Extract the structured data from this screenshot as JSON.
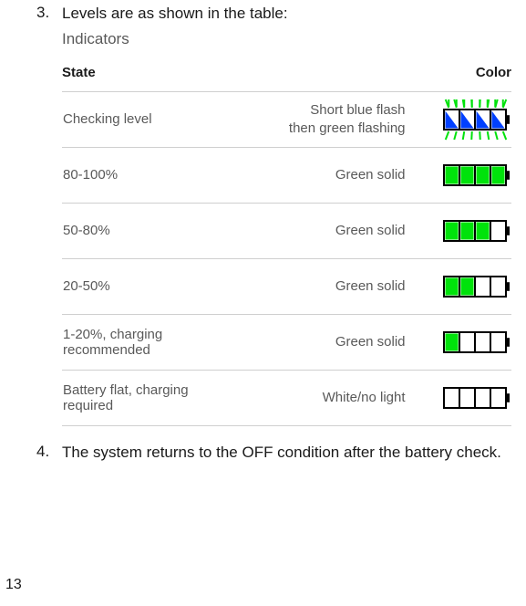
{
  "steps": {
    "item3": {
      "num": "3.",
      "text": "Levels are as shown in the table:"
    },
    "item4": {
      "num": "4.",
      "text": "The system returns to the OFF condition after the battery check."
    }
  },
  "indicators": {
    "title": "Indicators",
    "header_state": "State",
    "header_color": "Color",
    "colors": {
      "green": "#00e20b",
      "blue": "#0040ff",
      "outline": "#000000"
    },
    "rows": [
      {
        "state": "Checking level",
        "desc": "Short blue flash\nthen green flashing",
        "segments": 4,
        "fill": "blue_triangles_green_rays"
      },
      {
        "state": "80-100%",
        "desc": "Green solid",
        "segments": 4,
        "fill": 4
      },
      {
        "state": "50-80%",
        "desc": "Green solid",
        "segments": 4,
        "fill": 3
      },
      {
        "state": "20-50%",
        "desc": "Green solid",
        "segments": 4,
        "fill": 2
      },
      {
        "state": "1-20%, charging recommended",
        "desc": "Green solid",
        "segments": 4,
        "fill": 1
      },
      {
        "state": "Battery flat, charging required",
        "desc": "White/no light",
        "segments": 4,
        "fill": 0
      }
    ]
  },
  "page_number": "13"
}
